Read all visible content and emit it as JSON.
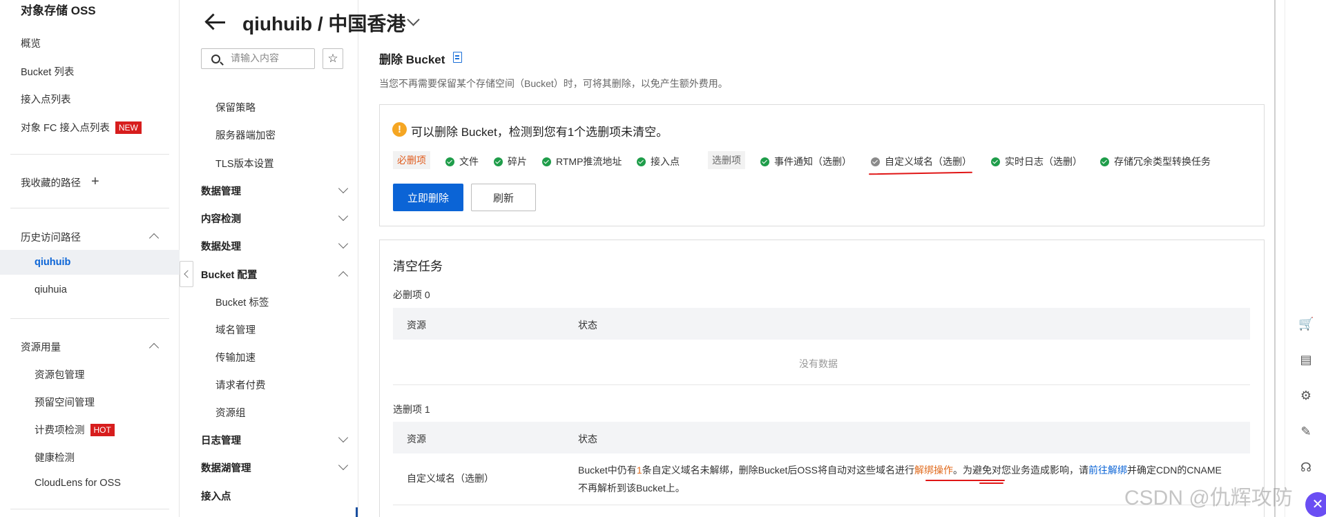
{
  "sidebar": {
    "title": "对象存储 OSS",
    "overview": "概览",
    "bucket_list": "Bucket 列表",
    "access_points": "接入点列表",
    "fc_access_points": "对象 FC 接入点列表",
    "new_badge": "NEW",
    "favorites": "我收藏的路径",
    "history": "历史访问路径",
    "history_items": [
      "qiuhuib",
      "qiuhuia"
    ],
    "resource_usage": "资源用量",
    "resource_items": [
      "资源包管理",
      "预留空间管理",
      "计费项检测",
      "健康检测",
      "CloudLens for OSS"
    ],
    "hot_badge": "HOT"
  },
  "subnav": {
    "search_placeholder": "请输入内容",
    "leaf_items_top": [
      "保留策略",
      "服务器端加密",
      "TLS版本设置"
    ],
    "groups": [
      "数据管理",
      "内容检测",
      "数据处理",
      "Bucket 配置"
    ],
    "bucket_config_items": [
      "Bucket 标签",
      "域名管理",
      "传输加速",
      "请求者付费",
      "资源组"
    ],
    "groups_bottom": [
      "日志管理",
      "数据湖管理",
      "接入点"
    ]
  },
  "header": {
    "title": "qiuhuib / 中国香港"
  },
  "delete_section": {
    "title": "删除 Bucket",
    "description": "当您不再需要保留某个存储空间（Bucket）时，可将其删除，以免产生额外费用。",
    "warning": "可以删除 Bucket，检测到您有1个选删项未清空。",
    "required_tag": "必删项",
    "required_items": [
      "文件",
      "碎片",
      "RTMP推流地址",
      "接入点"
    ],
    "optional_tag": "选删项",
    "optional_items": [
      "事件通知（选删）",
      "自定义域名（选删）",
      "实时日志（选删）",
      "存储冗余类型转换任务"
    ],
    "delete_button": "立即删除",
    "refresh_button": "刷新"
  },
  "clear_tasks": {
    "title": "清空任务",
    "required_label": "必删项 0",
    "col_resource": "资源",
    "col_status": "状态",
    "empty_text": "没有数据",
    "optional_label": "选删项 1",
    "row_name": "自定义域名（选删）",
    "row_status_part1": "Bucket中仍有",
    "row_status_count": "1",
    "row_status_part2": "条自定义域名未解绑，删除Bucket后OSS将自动对这些域名进行",
    "row_status_link1": "解绑操作",
    "row_status_part3": "。为避免对您业务造成影响，请",
    "row_status_link2": "前往解绑",
    "row_status_part4": "并确定CDN的CNAME不再解析到该Bucket上。"
  },
  "watermark": "CSDN @仇辉攻防",
  "icons": [
    "search-icon",
    "star-icon",
    "back-arrow-icon",
    "chevron-down-icon",
    "doc-icon",
    "warning-icon",
    "check-icon",
    "cart-icon",
    "ticket-icon",
    "gear-icon",
    "edit-icon",
    "headset-icon"
  ]
}
